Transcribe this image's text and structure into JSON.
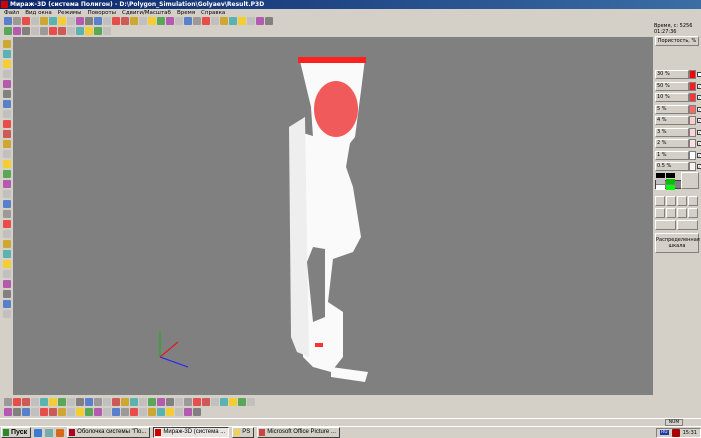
{
  "window": {
    "title": "Мираж-3D (система Полигон) - D:\\Polygon_Simulation\\Golyaev\\Result.P3D"
  },
  "menu": [
    "Файл",
    "Вид окна",
    "Режимы",
    "Повороты",
    "Сдвиги/Масштаб",
    "Время",
    "Справка"
  ],
  "info": {
    "time": "Время, с: 5256",
    "clock": "01:27:36",
    "mode_button": "Пористость, %"
  },
  "scale": [
    {
      "label": "30 %",
      "color": "#ff0000",
      "checked": false
    },
    {
      "label": "50 %",
      "color": "#ff1a1a",
      "checked": true
    },
    {
      "label": "10 %",
      "color": "#ff3333",
      "checked": true
    },
    {
      "label": "5 %",
      "color": "#ff6666",
      "checked": true
    },
    {
      "label": "4 %",
      "color": "#ffcccc",
      "checked": true
    },
    {
      "label": "3 %",
      "color": "#ffd6d6",
      "checked": true
    },
    {
      "label": "2 %",
      "color": "#ffe0e0",
      "checked": true
    },
    {
      "label": "1 %",
      "color": "#ffffff",
      "checked": true
    },
    {
      "label": "0.5 %",
      "color": "#fff0f0",
      "checked": true
    }
  ],
  "distribution_button": "Распределенная шкала",
  "status": {
    "num": "NUM"
  },
  "taskbar": {
    "start": "Пуск",
    "tasks": [
      "Оболочка системы \"По...",
      "Мираж-3D (система ...",
      "PS",
      "Microsoft Office Picture ..."
    ],
    "lang": "RU",
    "clock": "15:31"
  }
}
